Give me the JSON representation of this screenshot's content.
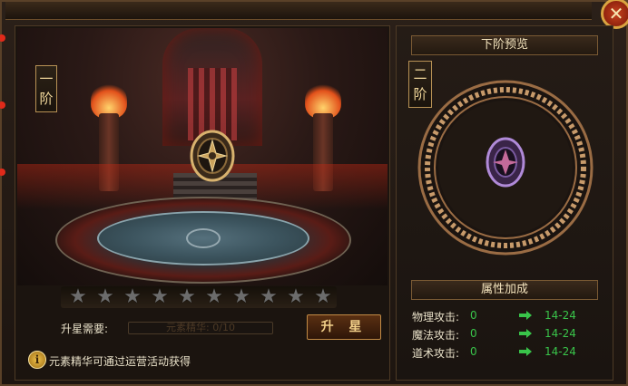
{
  "window": {
    "close_label": "✕"
  },
  "current": {
    "rank_chars": [
      "一",
      "阶"
    ],
    "stars_total": 10,
    "stars_filled": 0,
    "upgrade_label": "升星需要:",
    "progress_text": "元素精华: 0/10",
    "progress_fraction": 0,
    "upgrade_button": "升 星",
    "info_icon": "i",
    "info_text": "元素精华可通过运营活动获得"
  },
  "preview": {
    "header": "下阶预览",
    "rank_chars": [
      "二",
      "阶"
    ]
  },
  "attributes": {
    "header": "属性加成",
    "rows": [
      {
        "name": "物理攻击:",
        "current": "0",
        "next": "14-24"
      },
      {
        "name": "魔法攻击:",
        "current": "0",
        "next": "14-24"
      },
      {
        "name": "道术攻击:",
        "current": "0",
        "next": "14-24"
      }
    ]
  },
  "colors": {
    "accent_gold": "#c28b45",
    "value_green": "#39c44a",
    "star_empty": "#6c6c6c"
  },
  "icons": {
    "close": "close-icon",
    "info": "info-icon",
    "arrow": "arrow-right-icon",
    "star": "star-icon"
  }
}
